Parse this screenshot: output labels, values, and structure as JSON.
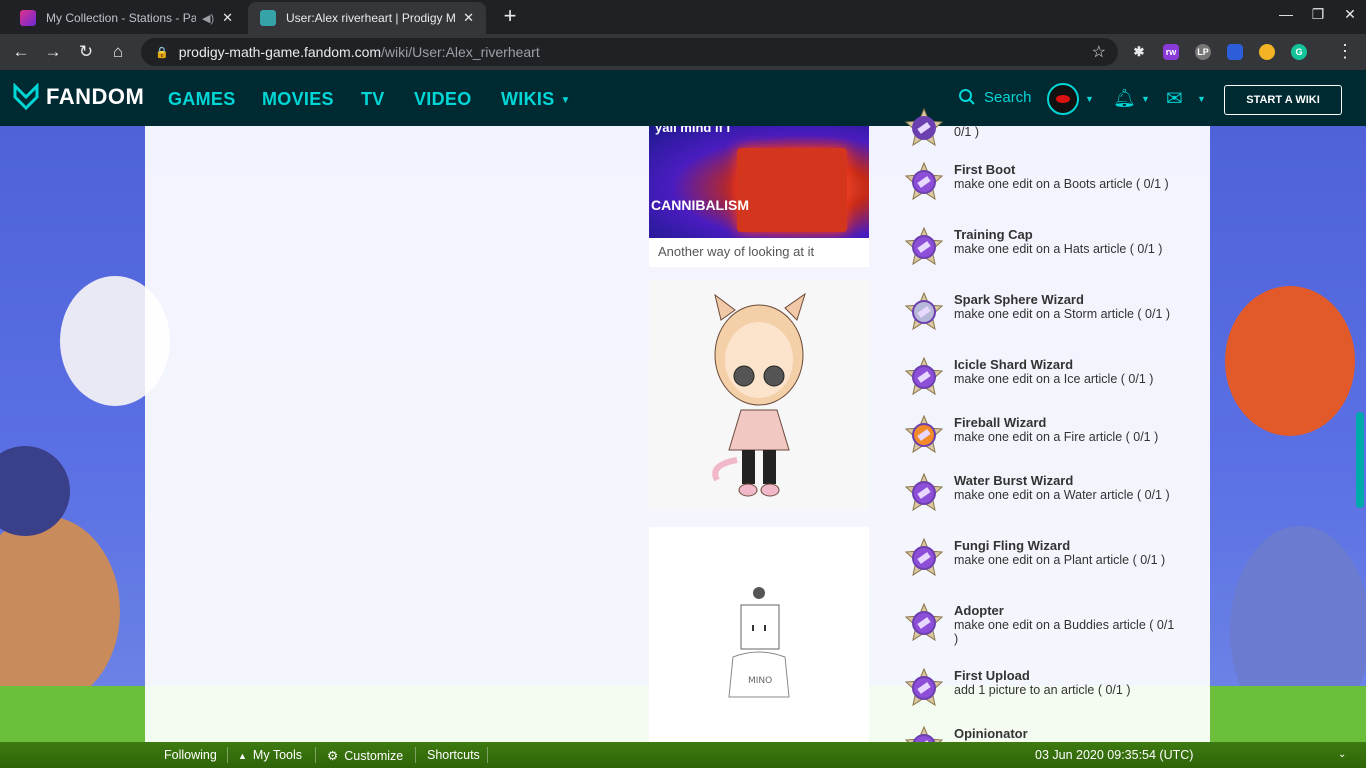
{
  "browser": {
    "tabs": [
      {
        "title": "My Collection - Stations - Pa",
        "active": false
      },
      {
        "title": "User:Alex riverheart | Prodigy Ma",
        "active": true
      }
    ],
    "url_host": "prodigy-math-game.fandom.com",
    "url_path": "/wiki/User:Alex_riverheart",
    "extensions": [
      "rw",
      "LP",
      "on"
    ]
  },
  "fandom_nav": {
    "logo": "FANDOM",
    "links": [
      "GAMES",
      "MOVIES",
      "TV",
      "VIDEO",
      "WIKIS"
    ],
    "search_label": "Search",
    "start_wiki": "START A WIKI"
  },
  "gallery": {
    "image1_top_text": "yall mind if I",
    "image1_text": "CANNIBALISM",
    "image1_caption": "Another way of looking at it",
    "image3_shirt_text": "MINO"
  },
  "badges": [
    {
      "name": "",
      "desc": "0/1 )",
      "icon": "generic-badge-icon"
    },
    {
      "name": "First Boot",
      "desc": "make one edit on a Boots article ( 0/1 )",
      "icon": "boot-badge-icon"
    },
    {
      "name": "Training Cap",
      "desc": "make one edit on a Hats article ( 0/1 )",
      "icon": "hat-badge-icon"
    },
    {
      "name": "Spark Sphere Wizard",
      "desc": "make one edit on a Storm article ( 0/1 )",
      "icon": "storm-badge-icon"
    },
    {
      "name": "Icicle Shard Wizard",
      "desc": "make one edit on a Ice article ( 0/1 )",
      "icon": "ice-badge-icon"
    },
    {
      "name": "Fireball Wizard",
      "desc": "make one edit on a Fire article ( 0/1 )",
      "icon": "fire-badge-icon"
    },
    {
      "name": "Water Burst Wizard",
      "desc": "make one edit on a Water article ( 0/1 )",
      "icon": "water-badge-icon"
    },
    {
      "name": "Fungi Fling Wizard",
      "desc": "make one edit on a Plant article ( 0/1 )",
      "icon": "plant-badge-icon"
    },
    {
      "name": "Adopter",
      "desc": "make one edit on a Buddies article ( 0/1 )",
      "icon": "buddy-badge-icon"
    },
    {
      "name": "First Upload",
      "desc": "add 1 picture to an article ( 0/1 )",
      "icon": "upload-badge-icon"
    },
    {
      "name": "Opinionator",
      "desc": "",
      "icon": "opinion-badge-icon"
    }
  ],
  "bottom_toolbar": {
    "following": "Following",
    "my_tools": "My Tools",
    "customize": "Customize",
    "shortcuts": "Shortcuts",
    "timestamp": "03 Jun 2020 09:35:54 (UTC)"
  },
  "colors": {
    "fandom_nav_bg": "#002a32",
    "fandom_accent": "#00d6d6",
    "toolbar_green": "#3d7a10",
    "page_bg_blue": "#5b70e4"
  }
}
